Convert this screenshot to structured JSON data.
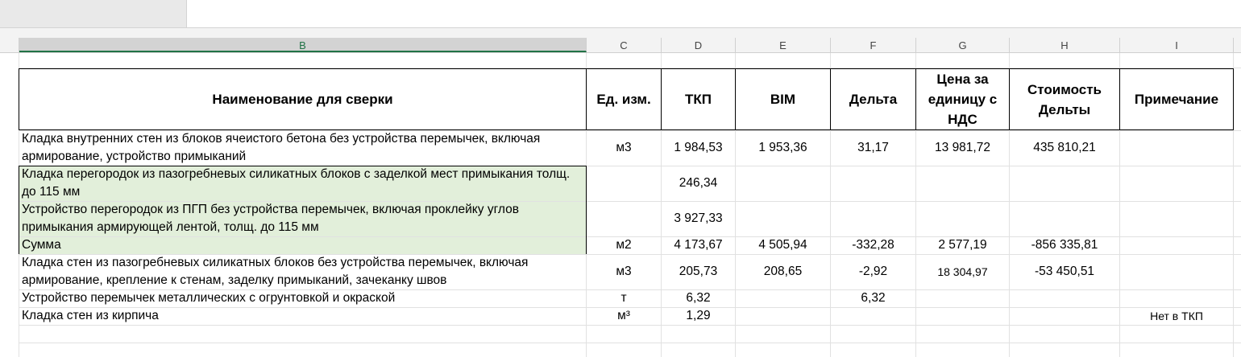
{
  "columns": [
    "B",
    "C",
    "D",
    "E",
    "F",
    "G",
    "H",
    "I"
  ],
  "header": {
    "name": "Наименование для сверки",
    "unit": "Ед. изм.",
    "tkp": "ТКП",
    "bim": "BIM",
    "delta": "Дельта",
    "price": "Цена за единицу с НДС",
    "cost": "Стоимость Дельты",
    "note": "Примечание"
  },
  "rows": [
    {
      "name": "Кладка внутренних стен из блоков ячеистого бетона без устройства перемычек, включая армирование, устройство примыканий",
      "unit": "м3",
      "tkp": "1 984,53",
      "bim": "1 953,36",
      "delta": "31,17",
      "price": "13 981,72",
      "cost": "435 810,21",
      "note": ""
    },
    {
      "name": "Кладка перегородок из пазогребневых силикатных блоков с заделкой мест примыкания толщ. до 115 мм",
      "unit": "",
      "tkp": "246,34",
      "bim": "",
      "delta": "",
      "price": "",
      "cost": "",
      "note": ""
    },
    {
      "name": "Устройство перегородок из ПГП без устройства перемычек, включая проклейку углов примыкания армирующей лентой, толщ. до 115 мм",
      "unit": "",
      "tkp": "3 927,33",
      "bim": "",
      "delta": "",
      "price": "",
      "cost": "",
      "note": ""
    },
    {
      "name": "Сумма",
      "unit": "м2",
      "tkp": "4 173,67",
      "bim": "4 505,94",
      "delta": "-332,28",
      "price": "2 577,19",
      "cost": "-856 335,81",
      "note": ""
    },
    {
      "name": "Кладка стен из пазогребневых силикатных блоков без устройства перемычек, включая армирование, крепление к стенам, заделку примыканий, зачеканку швов",
      "unit": "м3",
      "tkp": "205,73",
      "bim": "208,65",
      "delta": "-2,92",
      "price": "18 304,97",
      "cost": "-53 450,51",
      "note": ""
    },
    {
      "name": "Устройство перемычек металлических с огрунтовкой и окраской",
      "unit": "т",
      "tkp": "6,32",
      "bim": "",
      "delta": "6,32",
      "price": "",
      "cost": "",
      "note": ""
    },
    {
      "name": "Кладка стен из кирпича",
      "unit": "м³",
      "tkp": "1,29",
      "bim": "",
      "delta": "",
      "price": "",
      "cost": "",
      "note": "Нет в ТКП"
    }
  ]
}
